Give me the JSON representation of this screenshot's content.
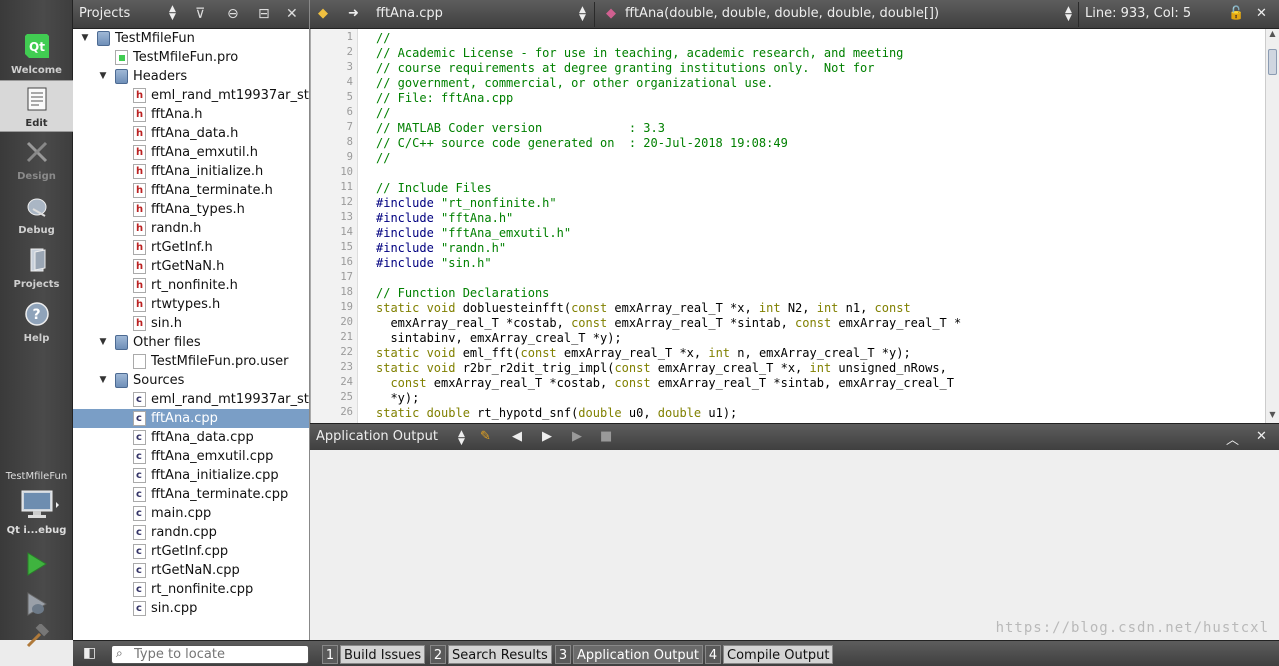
{
  "modes": {
    "welcome": "Welcome",
    "edit": "Edit",
    "design": "Design",
    "debug": "Debug",
    "projects": "Projects",
    "help": "Help"
  },
  "kit": {
    "project": "TestMfileFun",
    "config": "Qt i...ebug"
  },
  "projects_pane": {
    "title": "Projects",
    "tree": {
      "root": "TestMfileFun",
      "pro_file": "TestMfileFun.pro",
      "headers_label": "Headers",
      "headers": [
        "eml_rand_mt19937ar_st",
        "fftAna.h",
        "fftAna_data.h",
        "fftAna_emxutil.h",
        "fftAna_initialize.h",
        "fftAna_terminate.h",
        "fftAna_types.h",
        "randn.h",
        "rtGetInf.h",
        "rtGetNaN.h",
        "rt_nonfinite.h",
        "rtwtypes.h",
        "sin.h"
      ],
      "other_files_label": "Other files",
      "other_files": [
        "TestMfileFun.pro.user"
      ],
      "sources_label": "Sources",
      "sources": [
        "eml_rand_mt19937ar_st",
        "fftAna.cpp",
        "fftAna_data.cpp",
        "fftAna_emxutil.cpp",
        "fftAna_initialize.cpp",
        "fftAna_terminate.cpp",
        "main.cpp",
        "randn.cpp",
        "rtGetInf.cpp",
        "rtGetNaN.cpp",
        "rt_nonfinite.cpp",
        "sin.cpp"
      ],
      "selected": "fftAna.cpp"
    }
  },
  "editor_toolbar": {
    "file": "fftAna.cpp",
    "symbol": "fftAna(double, double, double, double, double[])",
    "position": "Line: 933, Col: 5"
  },
  "editor": {
    "line_numbers": [
      "1",
      "2",
      "3",
      "4",
      "5",
      "6",
      "7",
      "8",
      "9",
      "10",
      "11",
      "12",
      "13",
      "14",
      "15",
      "16",
      "17",
      "18",
      "19",
      "20",
      "21",
      "22",
      "23",
      "24",
      "25",
      "26"
    ],
    "lines": [
      [
        {
          "t": "cmt",
          "s": "//"
        }
      ],
      [
        {
          "t": "cmt",
          "s": "// Academic License - for use in teaching, academic research, and meeting"
        }
      ],
      [
        {
          "t": "cmt",
          "s": "// course requirements at degree granting institutions only.  Not for"
        }
      ],
      [
        {
          "t": "cmt",
          "s": "// government, commercial, or other organizational use."
        }
      ],
      [
        {
          "t": "cmt",
          "s": "// File: fftAna.cpp"
        }
      ],
      [
        {
          "t": "cmt",
          "s": "//"
        }
      ],
      [
        {
          "t": "cmt",
          "s": "// MATLAB Coder version            : 3.3"
        }
      ],
      [
        {
          "t": "cmt",
          "s": "// C/C++ source code generated on  : 20-Jul-2018 19:08:49"
        }
      ],
      [
        {
          "t": "cmt",
          "s": "//"
        }
      ],
      [],
      [
        {
          "t": "cmt",
          "s": "// Include Files"
        }
      ],
      [
        {
          "t": "pp",
          "s": "#include "
        },
        {
          "t": "str",
          "s": "\"rt_nonfinite.h\""
        }
      ],
      [
        {
          "t": "pp",
          "s": "#include "
        },
        {
          "t": "str",
          "s": "\"fftAna.h\""
        }
      ],
      [
        {
          "t": "pp",
          "s": "#include "
        },
        {
          "t": "str",
          "s": "\"fftAna_emxutil.h\""
        }
      ],
      [
        {
          "t": "pp",
          "s": "#include "
        },
        {
          "t": "str",
          "s": "\"randn.h\""
        }
      ],
      [
        {
          "t": "pp",
          "s": "#include "
        },
        {
          "t": "str",
          "s": "\"sin.h\""
        }
      ],
      [],
      [
        {
          "t": "cmt",
          "s": "// Function Declarations"
        }
      ],
      [
        {
          "t": "kw",
          "s": "static void"
        },
        {
          "t": "",
          "s": " dobluesteinfft("
        },
        {
          "t": "kw",
          "s": "const"
        },
        {
          "t": "",
          "s": " emxArray_real_T *x, "
        },
        {
          "t": "kw",
          "s": "int"
        },
        {
          "t": "",
          "s": " N2, "
        },
        {
          "t": "kw",
          "s": "int"
        },
        {
          "t": "",
          "s": " n1, "
        },
        {
          "t": "kw",
          "s": "const"
        }
      ],
      [
        {
          "t": "",
          "s": "  emxArray_real_T *costab, "
        },
        {
          "t": "kw",
          "s": "const"
        },
        {
          "t": "",
          "s": " emxArray_real_T *sintab, "
        },
        {
          "t": "kw",
          "s": "const"
        },
        {
          "t": "",
          "s": " emxArray_real_T *"
        }
      ],
      [
        {
          "t": "",
          "s": "  sintabinv, emxArray_creal_T *y);"
        }
      ],
      [
        {
          "t": "kw",
          "s": "static void"
        },
        {
          "t": "",
          "s": " eml_fft("
        },
        {
          "t": "kw",
          "s": "const"
        },
        {
          "t": "",
          "s": " emxArray_real_T *x, "
        },
        {
          "t": "kw",
          "s": "int"
        },
        {
          "t": "",
          "s": " n, emxArray_creal_T *y);"
        }
      ],
      [
        {
          "t": "kw",
          "s": "static void"
        },
        {
          "t": "",
          "s": " r2br_r2dit_trig_impl("
        },
        {
          "t": "kw",
          "s": "const"
        },
        {
          "t": "",
          "s": " emxArray_creal_T *x, "
        },
        {
          "t": "kw",
          "s": "int"
        },
        {
          "t": "",
          "s": " unsigned_nRows,"
        }
      ],
      [
        {
          "t": "",
          "s": "  "
        },
        {
          "t": "kw",
          "s": "const"
        },
        {
          "t": "",
          "s": " emxArray_real_T *costab, "
        },
        {
          "t": "kw",
          "s": "const"
        },
        {
          "t": "",
          "s": " emxArray_real_T *sintab, emxArray_creal_T"
        }
      ],
      [
        {
          "t": "",
          "s": "  *y);"
        }
      ],
      [
        {
          "t": "kw",
          "s": "static double"
        },
        {
          "t": "",
          "s": " rt_hypotd_snf("
        },
        {
          "t": "kw",
          "s": "double"
        },
        {
          "t": "",
          "s": " u0, "
        },
        {
          "t": "kw",
          "s": "double"
        },
        {
          "t": "",
          "s": " u1);"
        }
      ]
    ]
  },
  "output_pane": {
    "title": "Application Output",
    "watermark": "https://blog.csdn.net/hustcxl"
  },
  "statusbar": {
    "locator_placeholder": "Type to locate",
    "tabs": [
      {
        "num": "1",
        "name": "Build Issues"
      },
      {
        "num": "2",
        "name": "Search Results"
      },
      {
        "num": "3",
        "name": "Application Output"
      },
      {
        "num": "4",
        "name": "Compile Output"
      }
    ]
  }
}
